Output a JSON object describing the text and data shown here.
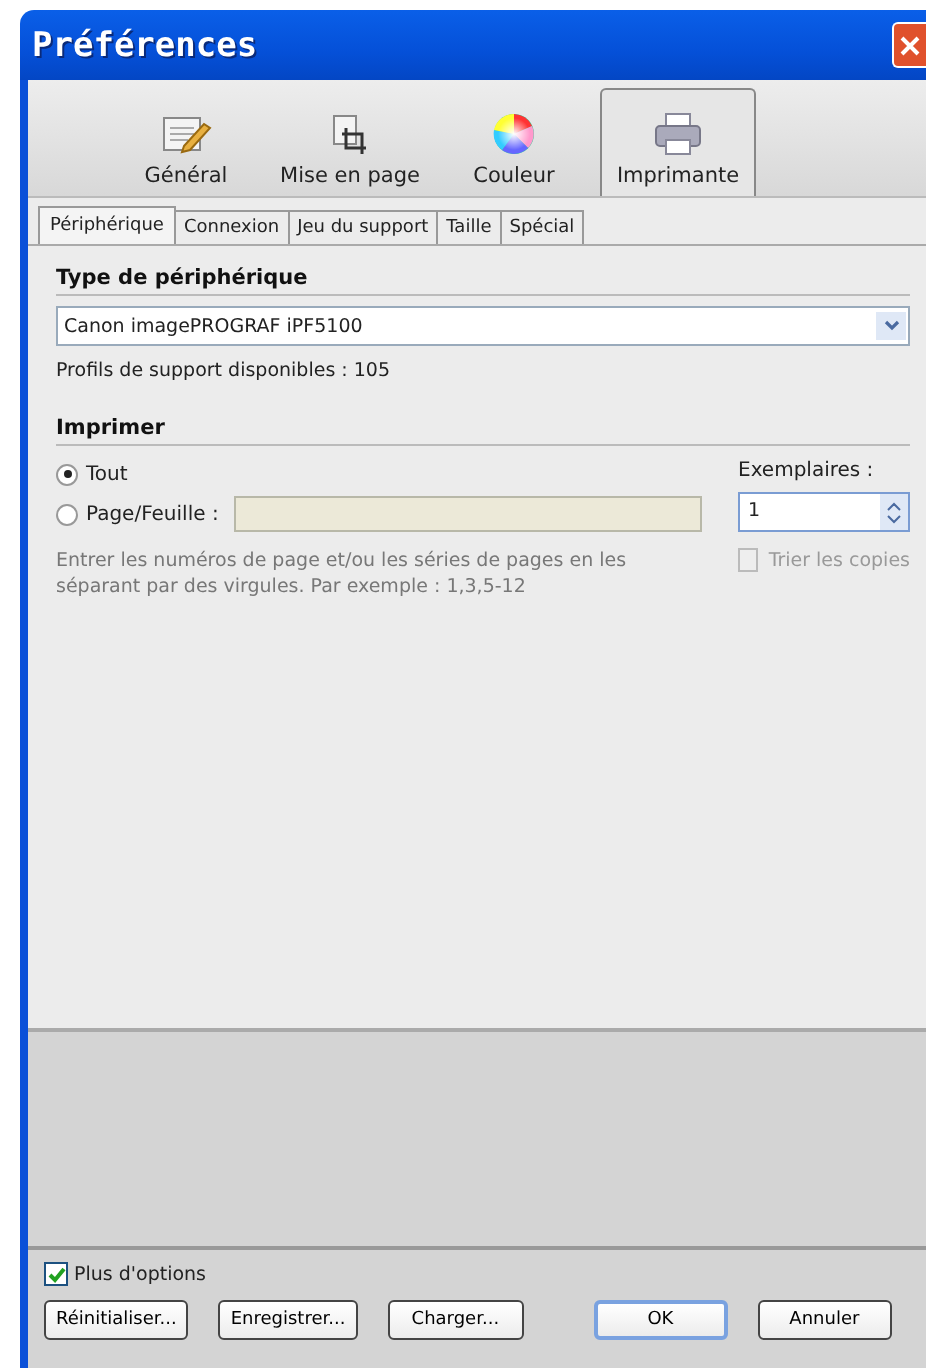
{
  "window": {
    "title": "Préférences"
  },
  "toolbar": [
    {
      "label": "Général",
      "kind": "notepad",
      "selected": false
    },
    {
      "label": "Mise en page",
      "kind": "crop",
      "selected": false
    },
    {
      "label": "Couleur",
      "kind": "color-wheel",
      "selected": false
    },
    {
      "label": "Imprimante",
      "kind": "printer",
      "selected": true
    }
  ],
  "subtabs": [
    {
      "label": "Périphérique",
      "selected": true
    },
    {
      "label": "Connexion",
      "selected": false
    },
    {
      "label": "Jeu du support",
      "selected": false
    },
    {
      "label": "Taille",
      "selected": false
    },
    {
      "label": "Spécial",
      "selected": false
    }
  ],
  "device_type": {
    "heading": "Type de périphérique",
    "value": "Canon imagePROGRAF iPF5100",
    "profiles_text": "Profils de support disponibles : 105"
  },
  "print": {
    "heading": "Imprimer",
    "options": [
      {
        "label": "Tout",
        "selected": true
      },
      {
        "label": "Page/Feuille :",
        "selected": false
      }
    ],
    "page_field": {
      "disabled": true
    },
    "hint": "Entrer les numéros de page et/ou les séries de pages en les séparant par des virgules. Par exemple : 1,3,5-12",
    "copies_label": "Exemplaires :",
    "copies_value": "1",
    "collate": {
      "label": "Trier les copies",
      "checked": false,
      "disabled": true
    }
  },
  "more_options": {
    "label": "Plus d'options",
    "checked": true
  },
  "buttons": [
    {
      "label": "Réinitialiser...",
      "default": false
    },
    {
      "label": "Enregistrer...",
      "default": false
    },
    {
      "label": "Charger...",
      "default": false
    },
    {
      "label": "OK",
      "default": true
    },
    {
      "label": "Annuler",
      "default": false
    }
  ]
}
